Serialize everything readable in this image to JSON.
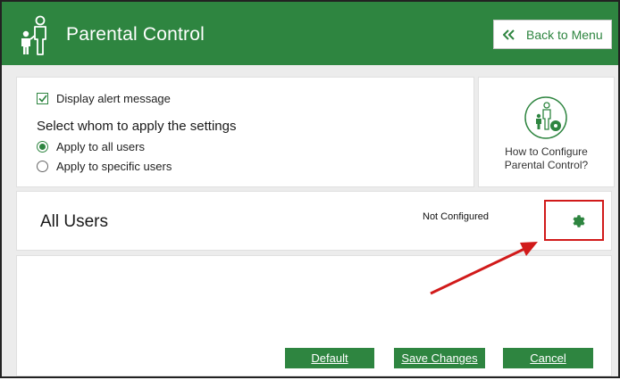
{
  "header": {
    "title": "Parental Control",
    "back_label": "Back to Menu",
    "color": "#2e8540"
  },
  "settings": {
    "display_alert_label": "Display alert message",
    "display_alert_checked": true,
    "heading": "Select whom to apply the settings",
    "options": [
      {
        "label": "Apply to all users",
        "selected": true
      },
      {
        "label": "Apply to specific users",
        "selected": false
      }
    ]
  },
  "help": {
    "line1": "How to Configure",
    "line2": "Parental Control?"
  },
  "users": {
    "title": "All Users",
    "status": "Not Configured"
  },
  "actions": {
    "default_label": "Default",
    "save_label": "Save Changes",
    "cancel_label": "Cancel"
  },
  "annotation_color": "#d11a1a",
  "icons": [
    "parent-child-icon",
    "chevron-double-left-icon",
    "checkmark-icon",
    "help-config-icon",
    "gear-icon"
  ]
}
